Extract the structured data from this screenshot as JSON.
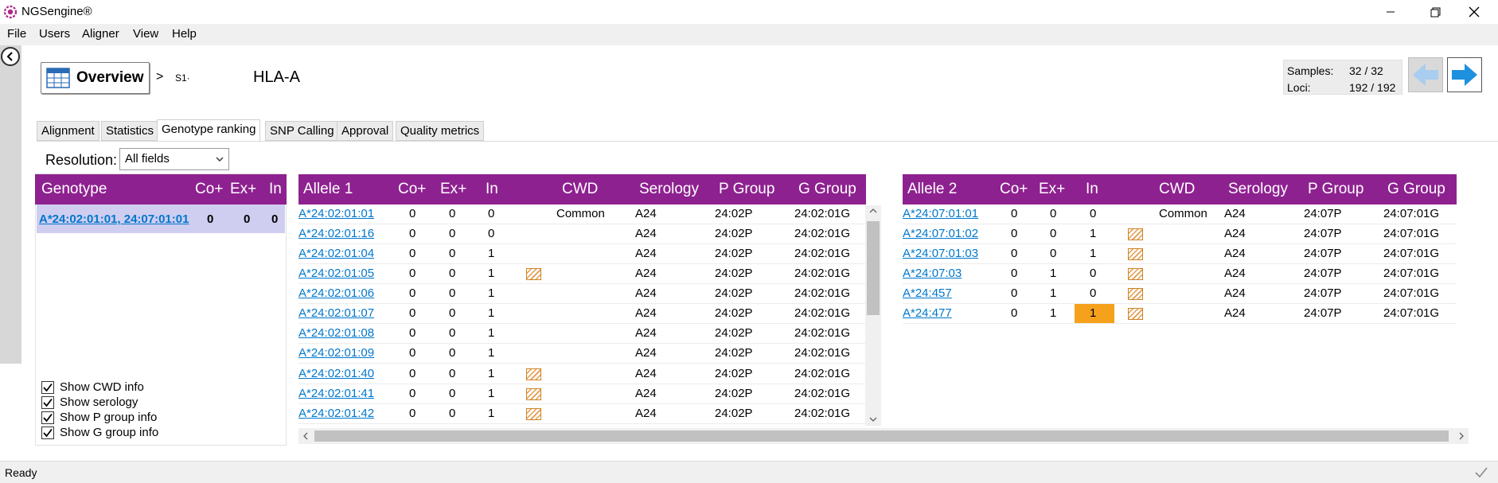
{
  "app": {
    "title": "NGSengine®"
  },
  "menu": [
    "File",
    "Users",
    "Aligner",
    "View",
    "Help"
  ],
  "header": {
    "overview_label": "Overview",
    "breadcrumb_sep": ">",
    "sample": "S1·",
    "locus": "HLA-A"
  },
  "counters": {
    "samples_label": "Samples:",
    "samples_value": "32 / 32",
    "loci_label": "Loci:",
    "loci_value": "192 / 192"
  },
  "tabs": [
    "Alignment",
    "Statistics",
    "Genotype ranking",
    "SNP Calling",
    "Approval",
    "Quality metrics"
  ],
  "active_tab": "Genotype ranking",
  "resolution": {
    "label": "Resolution:",
    "value": "All fields"
  },
  "genotype_table": {
    "headers": [
      "Genotype",
      "Co+",
      "Ex+",
      "In"
    ],
    "rows": [
      {
        "genotype": "A*24:02:01:01, 24:07:01:01",
        "co": "0",
        "ex": "0",
        "in": "0"
      }
    ]
  },
  "options": [
    "Show CWD info",
    "Show serology",
    "Show P group info",
    "Show G group info"
  ],
  "allele1": {
    "headers": [
      "Allele 1",
      "Co+",
      "Ex+",
      "In",
      "CWD",
      "Serology",
      "P Group",
      "G Group"
    ],
    "rows": [
      {
        "allele": "A*24:02:01:01",
        "co": "0",
        "ex": "0",
        "in": "0",
        "flag": false,
        "cwd": "Common",
        "sero": "A24",
        "p": "24:02P",
        "g": "24:02:01G"
      },
      {
        "allele": "A*24:02:01:16",
        "co": "0",
        "ex": "0",
        "in": "0",
        "flag": false,
        "cwd": "",
        "sero": "A24",
        "p": "24:02P",
        "g": "24:02:01G"
      },
      {
        "allele": "A*24:02:01:04",
        "co": "0",
        "ex": "0",
        "in": "1",
        "flag": false,
        "cwd": "",
        "sero": "A24",
        "p": "24:02P",
        "g": "24:02:01G"
      },
      {
        "allele": "A*24:02:01:05",
        "co": "0",
        "ex": "0",
        "in": "1",
        "flag": true,
        "cwd": "",
        "sero": "A24",
        "p": "24:02P",
        "g": "24:02:01G"
      },
      {
        "allele": "A*24:02:01:06",
        "co": "0",
        "ex": "0",
        "in": "1",
        "flag": false,
        "cwd": "",
        "sero": "A24",
        "p": "24:02P",
        "g": "24:02:01G"
      },
      {
        "allele": "A*24:02:01:07",
        "co": "0",
        "ex": "0",
        "in": "1",
        "flag": false,
        "cwd": "",
        "sero": "A24",
        "p": "24:02P",
        "g": "24:02:01G"
      },
      {
        "allele": "A*24:02:01:08",
        "co": "0",
        "ex": "0",
        "in": "1",
        "flag": false,
        "cwd": "",
        "sero": "A24",
        "p": "24:02P",
        "g": "24:02:01G"
      },
      {
        "allele": "A*24:02:01:09",
        "co": "0",
        "ex": "0",
        "in": "1",
        "flag": false,
        "cwd": "",
        "sero": "A24",
        "p": "24:02P",
        "g": "24:02:01G"
      },
      {
        "allele": "A*24:02:01:40",
        "co": "0",
        "ex": "0",
        "in": "1",
        "flag": true,
        "cwd": "",
        "sero": "A24",
        "p": "24:02P",
        "g": "24:02:01G"
      },
      {
        "allele": "A*24:02:01:41",
        "co": "0",
        "ex": "0",
        "in": "1",
        "flag": true,
        "cwd": "",
        "sero": "A24",
        "p": "24:02P",
        "g": "24:02:01G"
      },
      {
        "allele": "A*24:02:01:42",
        "co": "0",
        "ex": "0",
        "in": "1",
        "flag": true,
        "cwd": "",
        "sero": "A24",
        "p": "24:02P",
        "g": "24:02:01G"
      }
    ]
  },
  "allele2": {
    "headers": [
      "Allele 2",
      "Co+",
      "Ex+",
      "In",
      "CWD",
      "Serology",
      "P Group",
      "G Group"
    ],
    "rows": [
      {
        "allele": "A*24:07:01:01",
        "co": "0",
        "ex": "0",
        "in": "0",
        "flag": false,
        "highlight_in": false,
        "cwd": "Common",
        "sero": "A24",
        "p": "24:07P",
        "g": "24:07:01G"
      },
      {
        "allele": "A*24:07:01:02",
        "co": "0",
        "ex": "0",
        "in": "1",
        "flag": true,
        "highlight_in": false,
        "cwd": "",
        "sero": "A24",
        "p": "24:07P",
        "g": "24:07:01G"
      },
      {
        "allele": "A*24:07:01:03",
        "co": "0",
        "ex": "0",
        "in": "1",
        "flag": true,
        "highlight_in": false,
        "cwd": "",
        "sero": "A24",
        "p": "24:07P",
        "g": "24:07:01G"
      },
      {
        "allele": "A*24:07:03",
        "co": "0",
        "ex": "1",
        "in": "0",
        "flag": true,
        "highlight_in": false,
        "cwd": "",
        "sero": "A24",
        "p": "24:07P",
        "g": "24:07:01G"
      },
      {
        "allele": "A*24:457",
        "co": "0",
        "ex": "1",
        "in": "0",
        "flag": true,
        "highlight_in": false,
        "cwd": "",
        "sero": "A24",
        "p": "24:07P",
        "g": "24:07:01G"
      },
      {
        "allele": "A*24:477",
        "co": "0",
        "ex": "1",
        "in": "1",
        "flag": true,
        "highlight_in": true,
        "cwd": "",
        "sero": "A24",
        "p": "24:07P",
        "g": "24:07:01G"
      }
    ]
  },
  "status": {
    "text": "Ready"
  },
  "colors": {
    "header_purple": "#8e2190",
    "selected_row": "#cfcdf0",
    "link": "#0077cc",
    "highlight": "#f5a11c",
    "hatch": "#e39a4a",
    "nav_arrow": "#1e90e0"
  }
}
